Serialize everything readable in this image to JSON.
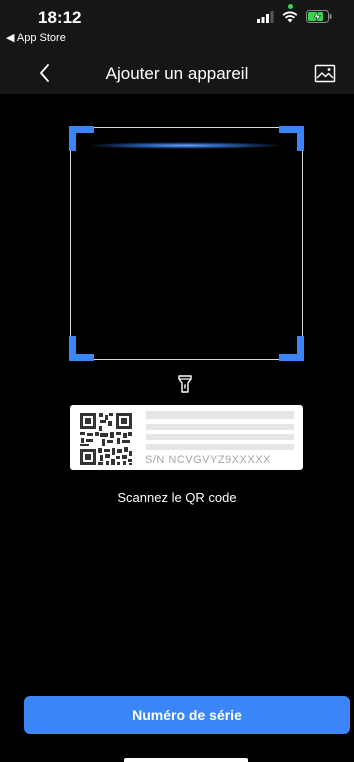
{
  "status": {
    "time": "18:12",
    "back_app": "◀ App Store"
  },
  "nav": {
    "title": "Ajouter un appareil",
    "back_icon": "chevron-left-icon",
    "gallery_icon": "image-icon"
  },
  "scanner": {
    "flashlight_icon": "flashlight-icon",
    "sample_serial": "S/N  NCVGVYZ9XXXXX",
    "caption": "Scannez le QR code"
  },
  "actions": {
    "serial_button_label": "Numéro de série"
  },
  "colors": {
    "accent": "#3a86f7",
    "background": "#000000",
    "bar": "#161616"
  }
}
